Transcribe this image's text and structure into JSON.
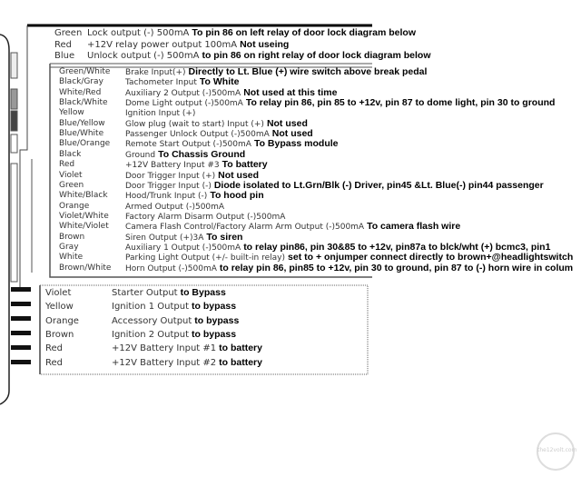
{
  "top_group": [
    {
      "color": "Green",
      "function": "Lock output (-) 500mA",
      "note": "To pin 86 on left relay of door lock diagram below"
    },
    {
      "color": "Red",
      "function": "+12V relay power output 100mA",
      "note": "Not useing"
    },
    {
      "color": "Blue",
      "function": "Unlock output (-) 500mA",
      "note": "to pin 86 on right relay of door lock diagram below"
    }
  ],
  "main_group": [
    {
      "color": "Green/White",
      "function": "Brake Input(+)",
      "note": "Directly to Lt. Blue (+) wire switch above break pedal"
    },
    {
      "color": "Black/Gray",
      "function": "Tachometer Input",
      "note": "To White"
    },
    {
      "color": "White/Red",
      "function": "Auxiliary 2 Output (-)500mA",
      "note": "Not used at this time"
    },
    {
      "color": "Black/White",
      "function": "Dome Light output (-)500mA",
      "note": "To relay pin 86, pin 85 to +12v, pin 87 to dome light, pin 30 to ground"
    },
    {
      "color": "Yellow",
      "function": "Ignition Input (+)",
      "note": ""
    },
    {
      "color": "Blue/Yellow",
      "function": "Glow plug (wait to start) Input (+)",
      "note": "Not used"
    },
    {
      "color": "Blue/White",
      "function": "Passenger Unlock Output (-)500mA",
      "note": "Not used"
    },
    {
      "color": "Blue/Orange",
      "function": "Remote Start Output (-)500mA",
      "note": "To Bypass module"
    },
    {
      "color": "Black",
      "function": "Ground",
      "note": "To Chassis Ground"
    },
    {
      "color": "Red",
      "function": "+12V Battery Input #3",
      "note": "To battery"
    },
    {
      "color": "Violet",
      "function": "Door Trigger Input (+)",
      "note": "Not used"
    },
    {
      "color": "Green",
      "function": "Door Trigger Input (-)",
      "note": "Diode isolated to Lt.Grn/Blk (-) Driver, pin45 &Lt. Blue(-) pin44 passenger"
    },
    {
      "color": "White/Black",
      "function": "Hood/Trunk Input (-)",
      "note": "To hood pin"
    },
    {
      "color": "Orange",
      "function": "Armed Output (-)500mA",
      "note": ""
    },
    {
      "color": "Violet/White",
      "function": "Factory Alarm Disarm Output (-)500mA",
      "note": ""
    },
    {
      "color": "White/Violet",
      "function": "Camera Flash Control/Factory Alarm Arm Output (-)500mA",
      "note": "To camera flash wire"
    },
    {
      "color": "Brown",
      "function": "Siren Output (+)3A",
      "note": "To siren"
    },
    {
      "color": "Gray",
      "function": "Auxiliary 1 Output (-)500mA",
      "note": "to relay pin86, pin 30&85 to +12v, pin87a to blck/wht (+) bcmc3, pin1"
    },
    {
      "color": "White",
      "function": "Parking Light Output (+/- built-in relay)",
      "note": "set to + onjumper connect directly to brown+@headlightswitch"
    },
    {
      "color": "Brown/White",
      "function": "Horn Output (-)500mA",
      "note": "to relay pin 86, pin85 to +12v, pin 30 to ground, pin 87 to (-) horn wire in colum"
    }
  ],
  "bottom_group": [
    {
      "color": "Violet",
      "function": "Starter Output",
      "note": "to Bypass"
    },
    {
      "color": "Yellow",
      "function": "Ignition 1 Output",
      "note": "to bypass"
    },
    {
      "color": "Orange",
      "function": "Accessory Output",
      "note": "to bypass"
    },
    {
      "color": "Brown",
      "function": "Ignition 2 Output",
      "note": "to bypass"
    },
    {
      "color": "Red",
      "function": "+12V Battery Input #1",
      "note": "to battery"
    },
    {
      "color": "Red",
      "function": "+12V Battery Input #2",
      "note": "to battery"
    }
  ],
  "watermark": "the12volt.com"
}
